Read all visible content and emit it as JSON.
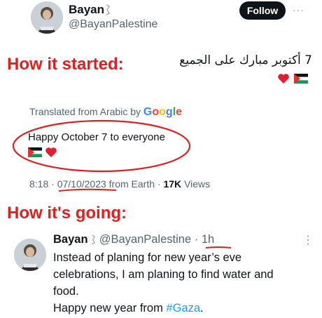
{
  "tweet1": {
    "name": "Bayan",
    "handle": "@BayanPalestine",
    "follow_label": "Follow",
    "more": "···",
    "arabic_text": "7 أكتوبر مبارك على الجميع",
    "translated_prefix": "Translated from Arabic by",
    "translated_brand": "Google",
    "translation_line1": "Happy October 7 to everyone",
    "time": "8:18",
    "date": "07/10/2023",
    "source": "from Earth",
    "views_count": "17K",
    "views_label": "Views"
  },
  "labels": {
    "started": "How it started:",
    "going": "How it's going:"
  },
  "tweet2": {
    "name": "Bayan",
    "handle": "@BayanPalestine",
    "age": "· 1h",
    "line1": "Instead of planing for new year’s eve",
    "line2": "celebrations, I am planing to find water and",
    "line3": "food.",
    "line4_prefix": "Happy new year from",
    "hashtag": "#Gaza",
    "line4_suffix": ".",
    "more": "⋮"
  },
  "colors": {
    "annotation_red": "#e02020",
    "link_blue": "#1d9bf0",
    "follow_bg": "#0f1419"
  },
  "icons": [
    "verified-badge-icon",
    "palestine-flag-icon",
    "red-heart-icon",
    "more-options-icon"
  ]
}
